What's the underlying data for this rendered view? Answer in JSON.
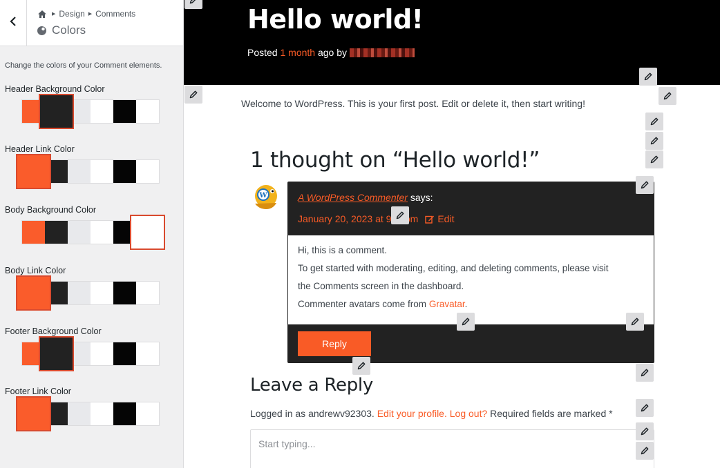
{
  "customizer": {
    "breadcrumb": [
      "Design",
      "Comments"
    ],
    "panel_title": "Colors",
    "description": "Change the colors of your Comment elements.",
    "palette": [
      "#fa5c2b",
      "#222222",
      "#e8e9ec",
      "#ffffff",
      "#050505",
      "#ffffff"
    ],
    "controls": [
      {
        "label": "Header Background Color",
        "selected_index": 1
      },
      {
        "label": "Header Link Color",
        "selected_index": 0
      },
      {
        "label": "Body Background Color",
        "selected_index": 5
      },
      {
        "label": "Body Link Color",
        "selected_index": 0
      },
      {
        "label": "Footer Background Color",
        "selected_index": 1
      },
      {
        "label": "Footer Link Color",
        "selected_index": 0
      }
    ]
  },
  "preview": {
    "post_title": "Hello world!",
    "meta_posted": "Posted",
    "meta_time": "1 month",
    "meta_ago_by": "ago by",
    "post_body": "Welcome to WordPress. This is your first post. Edit or delete it, then start writing!",
    "comments_title": "1 thought on “Hello world!”",
    "comment": {
      "author": "A WordPress Commenter",
      "says": "says:",
      "date": "January 20, 2023 at 9:__pm",
      "edit_label": "Edit",
      "lines": [
        "Hi, this is a comment.",
        "To get started with moderating, editing, and deleting comments, please visit",
        "the Comments screen in the dashboard."
      ],
      "avatars_prefix": "Commenter avatars come from",
      "gravatar_link": "Gravatar",
      "avatars_suffix": ".",
      "reply_label": "Reply"
    },
    "reply_section_title": "Leave a Reply",
    "logged_in_as": "Logged in as andrewv92303.",
    "edit_profile_link": "Edit your profile.",
    "logout_link": "Log out?",
    "required_note": "Required fields are marked *",
    "textarea_placeholder": "Start typing..."
  },
  "colors": {
    "accent": "#f95b26",
    "header_bg": "#000000",
    "comment_bg": "#222222"
  },
  "icons": [
    "chevron-left-icon",
    "home-icon",
    "palette-icon",
    "pencil-icon",
    "edit-icon",
    "avatar"
  ]
}
